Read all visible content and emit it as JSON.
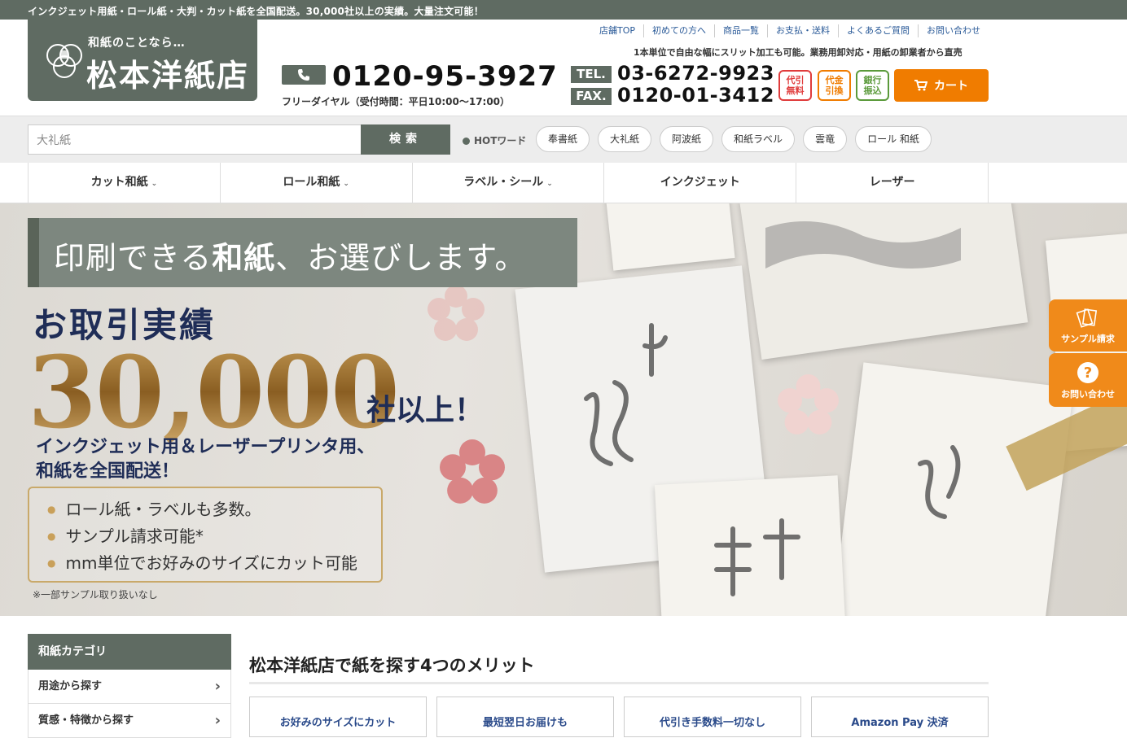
{
  "topbar": {
    "announcement": "インクジェット用紙・ロール紙・大判・カット紙を全国配送。30,000社以上の実績。大量注文可能！"
  },
  "logo": {
    "tagline": "和紙のことなら…",
    "name": "松本洋紙店"
  },
  "topnav": [
    "店舗TOP",
    "初めての方へ",
    "商品一覧",
    "お支払・送料",
    "よくあるご質問",
    "お問い合わせ"
  ],
  "slit_note": "1本単位で自由な幅にスリット加工も可能。業務用卸対応・用紙の卸業者から直売",
  "contact": {
    "freedial": "0120-95-3927",
    "freedial_note": "フリーダイヤル（受付時間：平日10:00〜17:00）",
    "tel_label": "TEL.",
    "tel": "03-6272-9923",
    "fax_label": "FAX.",
    "fax": "0120-01-3412"
  },
  "payments": [
    {
      "label": "代引無料",
      "color": "#e03c3c"
    },
    {
      "label": "代金引換",
      "color": "#f07c00"
    },
    {
      "label": "銀行振込",
      "color": "#5a9a3a"
    }
  ],
  "cart": {
    "label": "カート"
  },
  "search": {
    "value": "大礼紙",
    "button": "検索",
    "hot_label": "HOTワード",
    "hot_words": [
      "奉書紙",
      "大礼紙",
      "阿波紙",
      "和紙ラベル",
      "雲竜",
      "ロール 和紙"
    ]
  },
  "category_nav": [
    {
      "label": "カット和紙",
      "dropdown": true
    },
    {
      "label": "ロール和紙",
      "dropdown": true
    },
    {
      "label": "ラベル・シール",
      "dropdown": true
    },
    {
      "label": "インクジェット",
      "dropdown": false
    },
    {
      "label": "レーザー",
      "dropdown": false
    }
  ],
  "hero": {
    "headline_pre": "印刷できる",
    "headline_bold": "和紙",
    "headline_post": "、お選びします。",
    "records_label": "お取引実績",
    "big_number": "30,000",
    "big_suffix": "社以上！",
    "subhead_line1": "インクジェット用＆レーザープリンタ用、",
    "subhead_line2": "和紙を全国配送！",
    "bullets": [
      "ロール紙・ラベルも多数。",
      "サンプル請求可能*",
      "mm単位でお好みのサイズにカット可能"
    ],
    "note": "※一部サンプル取り扱いなし"
  },
  "side_tabs": [
    {
      "label": "サンプル請求",
      "icon": "sample-cards-icon"
    },
    {
      "label": "お問い合わせ",
      "icon": "question-icon"
    }
  ],
  "sidebar": {
    "title": "和紙カテゴリ",
    "items": [
      "用途から探す",
      "質感・特徴から探す"
    ]
  },
  "merits": {
    "title": "松本洋紙店で紙を探す4つのメリット",
    "items": [
      "お好みのサイズにカット",
      "最短翌日お届けも",
      "代引き手数料一切なし",
      "Amazon Pay 決済"
    ]
  }
}
